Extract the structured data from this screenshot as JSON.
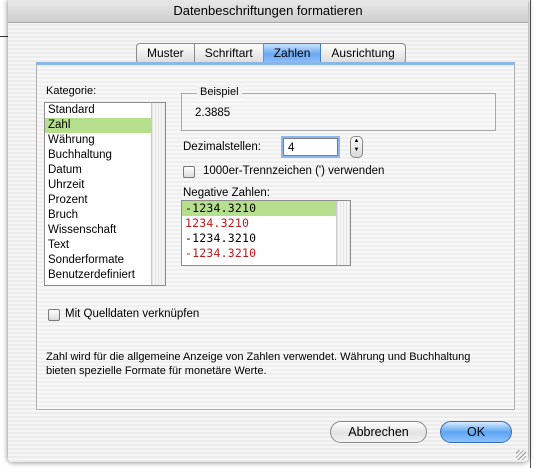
{
  "dialog": {
    "title": "Datenbeschriftungen formatieren"
  },
  "tabs": [
    {
      "label": "Muster",
      "active": false
    },
    {
      "label": "Schriftart",
      "active": false
    },
    {
      "label": "Zahlen",
      "active": true
    },
    {
      "label": "Ausrichtung",
      "active": false
    }
  ],
  "category": {
    "label": "Kategorie:",
    "items": [
      "Standard",
      "Zahl",
      "Währung",
      "Buchhaltung",
      "Datum",
      "Uhrzeit",
      "Prozent",
      "Bruch",
      "Wissenschaft",
      "Text",
      "Sonderformate",
      "Benutzerdefiniert"
    ],
    "selected": "Zahl"
  },
  "example": {
    "label": "Beispiel",
    "value": "2.3885"
  },
  "decimals": {
    "label": "Dezimalstellen:",
    "value": "4"
  },
  "thousands": {
    "label": "1000er-Trennzeichen (') verwenden",
    "checked": false
  },
  "negative": {
    "label": "Negative Zahlen:",
    "items": [
      {
        "text": "-1234.3210",
        "red": false,
        "selected": true
      },
      {
        "text": "1234.3210",
        "red": true,
        "selected": false
      },
      {
        "text": "-1234.3210",
        "red": false,
        "selected": false
      },
      {
        "text": "-1234.3210",
        "red": true,
        "selected": false
      }
    ]
  },
  "link_source": {
    "label": "Mit Quelldaten verknüpfen",
    "checked": false
  },
  "description": "Zahl wird für die allgemeine Anzeige von Zahlen verwendet. Währung und Buchhaltung bieten spezielle Formate für monetäre Werte.",
  "buttons": {
    "cancel": "Abbrechen",
    "ok": "OK"
  },
  "colors": {
    "selection": "#b5df8c",
    "negative_red": "#c21818",
    "accent_blue": "#5ea5f2"
  }
}
